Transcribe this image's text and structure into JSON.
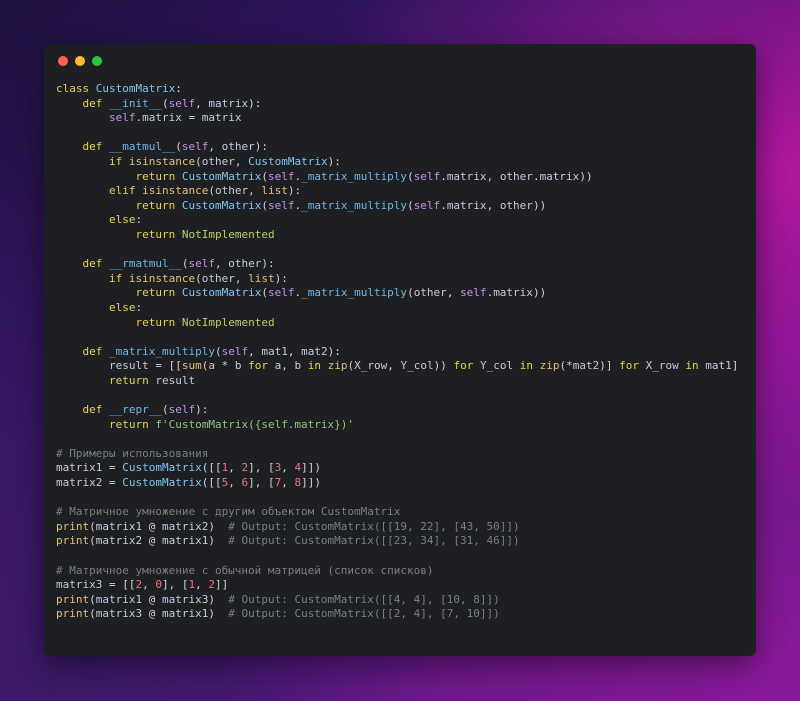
{
  "window": {
    "controls": {
      "close_color": "#ff5f57",
      "minimize_color": "#febc2e",
      "maximize_color": "#28c840"
    }
  },
  "code": {
    "language": "python",
    "lines": [
      "class CustomMatrix:",
      "    def __init__(self, matrix):",
      "        self.matrix = matrix",
      "",
      "    def __matmul__(self, other):",
      "        if isinstance(other, CustomMatrix):",
      "            return CustomMatrix(self._matrix_multiply(self.matrix, other.matrix))",
      "        elif isinstance(other, list):",
      "            return CustomMatrix(self._matrix_multiply(self.matrix, other))",
      "        else:",
      "            return NotImplemented",
      "",
      "    def __rmatmul__(self, other):",
      "        if isinstance(other, list):",
      "            return CustomMatrix(self._matrix_multiply(other, self.matrix))",
      "        else:",
      "            return NotImplemented",
      "",
      "    def _matrix_multiply(self, mat1, mat2):",
      "        result = [[sum(a * b for a, b in zip(X_row, Y_col)) for Y_col in zip(*mat2)] for X_row in mat1]",
      "        return result",
      "",
      "    def __repr__(self):",
      "        return f'CustomMatrix({self.matrix})'",
      "",
      "# Примеры использования",
      "matrix1 = CustomMatrix([[1, 2], [3, 4]])",
      "matrix2 = CustomMatrix([[5, 6], [7, 8]])",
      "",
      "# Матричное умножение с другим объектом CustomMatrix",
      "print(matrix1 @ matrix2)  # Output: CustomMatrix([[19, 22], [43, 50]])",
      "print(matrix2 @ matrix1)  # Output: CustomMatrix([[23, 34], [31, 46]])",
      "",
      "# Матричное умножение с обычной матрицей (список списков)",
      "matrix3 = [[2, 0], [1, 2]]",
      "print(matrix1 @ matrix3)  # Output: CustomMatrix([[4, 4], [10, 8]])",
      "print(matrix3 @ matrix1)  # Output: CustomMatrix([[2, 4], [7, 10]])"
    ]
  }
}
